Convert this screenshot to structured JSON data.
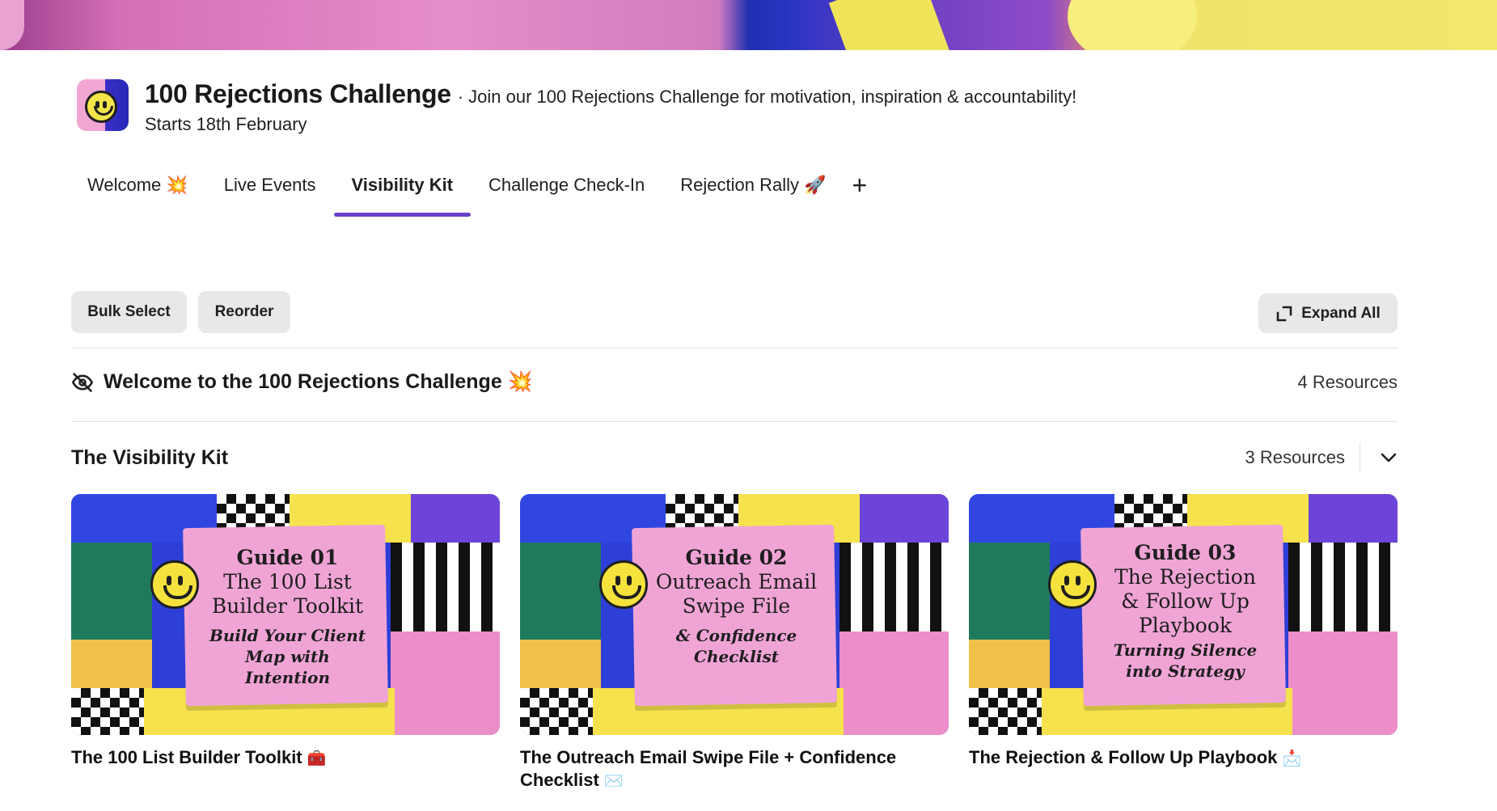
{
  "community": {
    "title": "100 Rejections Challenge",
    "tagline": "· Join our 100 Rejections Challenge for motivation, inspiration & accountability!",
    "subtitle": "Starts 18th February"
  },
  "tabs": [
    {
      "label": "Welcome 💥"
    },
    {
      "label": "Live Events"
    },
    {
      "label": "Visibility Kit"
    },
    {
      "label": "Challenge Check-In"
    },
    {
      "label": "Rejection Rally 🚀"
    }
  ],
  "tab_add": "+",
  "toolbar": {
    "bulk_select": "Bulk Select",
    "reorder": "Reorder",
    "expand_all": "Expand All"
  },
  "sections": [
    {
      "title": "Welcome to the 100 Rejections Challenge 💥",
      "count": "4 Resources"
    },
    {
      "title": "The Visibility Kit",
      "count": "3 Resources"
    }
  ],
  "cards": [
    {
      "title": "The 100 List Builder Toolkit",
      "title_emoji": "🧰",
      "thumb_heading": "Guide 01",
      "thumb_lines": [
        "The 100 List",
        "Builder Toolkit"
      ],
      "thumb_sub": [
        "Build Your Client",
        "Map with Intention"
      ]
    },
    {
      "title": "The Outreach Email Swipe File + Confidence Checklist",
      "title_emoji": "✉️",
      "thumb_heading": "Guide 02",
      "thumb_lines": [
        "Outreach Email",
        "Swipe File"
      ],
      "thumb_sub": [
        "& Confidence",
        "Checklist"
      ]
    },
    {
      "title": "The Rejection & Follow Up Playbook",
      "title_emoji": "📩",
      "thumb_heading": "Guide 03",
      "thumb_lines": [
        "The Rejection",
        "& Follow Up",
        "Playbook"
      ],
      "thumb_sub": [
        "Turning Silence",
        "into Strategy"
      ]
    }
  ],
  "colors": {
    "active_tab_underline": "#6a3fc9",
    "button_bg": "#e8e8e8",
    "thumb_pink": "#f0a4d6",
    "thumb_blue": "#2d3fd6"
  }
}
